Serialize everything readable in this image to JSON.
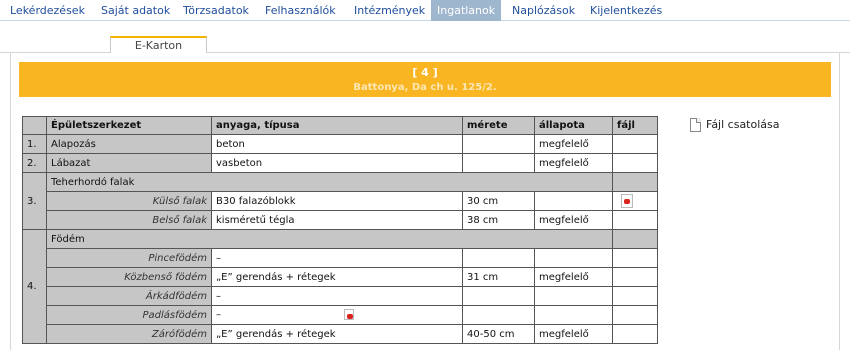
{
  "nav": {
    "items": [
      {
        "label": "Lekérdezések"
      },
      {
        "label": "Saját adatok"
      },
      {
        "label": "Törzsadatok"
      },
      {
        "label": "Felhasználók"
      },
      {
        "label": "Intézmények"
      },
      {
        "label": "Ingatlanok"
      },
      {
        "label": "Naplózások"
      },
      {
        "label": "Kijelentkezés"
      }
    ],
    "active_label": "Ingatlanok",
    "active_color": "#9fb6cf"
  },
  "tab": {
    "label": "E-Karton"
  },
  "banner": {
    "id": "[ 4 ]",
    "address": "Battonya, Da        ch u. 125/2.",
    "color": "#f9b522"
  },
  "table": {
    "headers": [
      "Épületszerkezet",
      "anyaga, típusa",
      "mérete",
      "állapota",
      "fájl"
    ],
    "rows": {
      "r1": {
        "num": "1.",
        "name": "Alapozás",
        "material": "beton",
        "size": "",
        "state": "megfelelő"
      },
      "r2": {
        "num": "2.",
        "name": "Lábazat",
        "material": "vasbeton",
        "size": "",
        "state": "megfelelő"
      },
      "r3": {
        "num": "3.",
        "name": "Teherhordó falak"
      },
      "r3a": {
        "name": "Külső falak",
        "material": "B30 falazóblokk",
        "size": "30 cm",
        "state": ""
      },
      "r3b": {
        "name": "Belső falak",
        "material": "kisméretű tégla",
        "size": "38 cm",
        "state": "megfelelő"
      },
      "r4": {
        "num": "4.",
        "name": "Födém"
      },
      "r4a": {
        "name": "Pincefödém",
        "material": "–",
        "size": "",
        "state": ""
      },
      "r4b": {
        "name": "Közbenső födém",
        "material": "„E” gerendás + rétegek",
        "size": "31 cm",
        "state": "megfelelő"
      },
      "r4c": {
        "name": "Árkádfödém",
        "material": "–",
        "size": "",
        "state": ""
      },
      "r4d": {
        "name": "Padlásfödém",
        "material": "–",
        "size": "",
        "state": ""
      },
      "r4e": {
        "name": "Zárófödém",
        "material": "„E” gerendás + rétegek",
        "size": "40-50 cm",
        "state": "megfelelő"
      }
    }
  },
  "attach": {
    "label": "Fájl csatolása",
    "icon": "document-icon"
  },
  "icons": {
    "file": "pdf-icon"
  }
}
